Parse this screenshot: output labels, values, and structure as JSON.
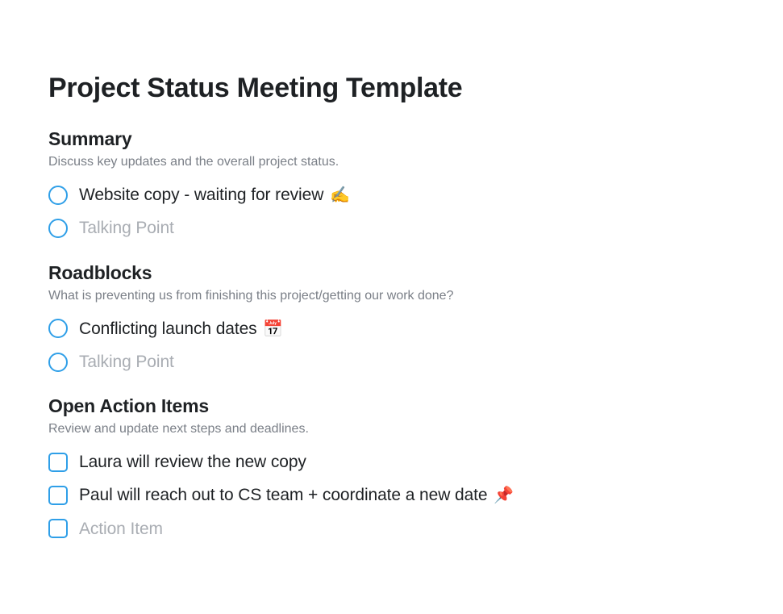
{
  "title": "Project Status Meeting Template",
  "sections": {
    "summary": {
      "heading": "Summary",
      "subtext": "Discuss key updates and the overall project status.",
      "items": [
        {
          "text": "Website copy - waiting for review",
          "emoji": "✍️",
          "placeholder": false
        },
        {
          "text": "Talking Point",
          "emoji": "",
          "placeholder": true
        }
      ]
    },
    "roadblocks": {
      "heading": "Roadblocks",
      "subtext": "What is preventing us from finishing this project/getting our work done?",
      "items": [
        {
          "text": "Conflicting launch dates",
          "emoji": "📅",
          "placeholder": false
        },
        {
          "text": "Talking Point",
          "emoji": "",
          "placeholder": true
        }
      ]
    },
    "openActionItems": {
      "heading": "Open Action Items",
      "subtext": "Review and update next steps and deadlines.",
      "items": [
        {
          "text": "Laura will review the new copy",
          "emoji": "",
          "placeholder": false
        },
        {
          "text": "Paul will reach out to CS team + coordinate a new date",
          "emoji": "📌",
          "placeholder": false
        },
        {
          "text": "Action Item",
          "emoji": "",
          "placeholder": true
        }
      ]
    }
  }
}
